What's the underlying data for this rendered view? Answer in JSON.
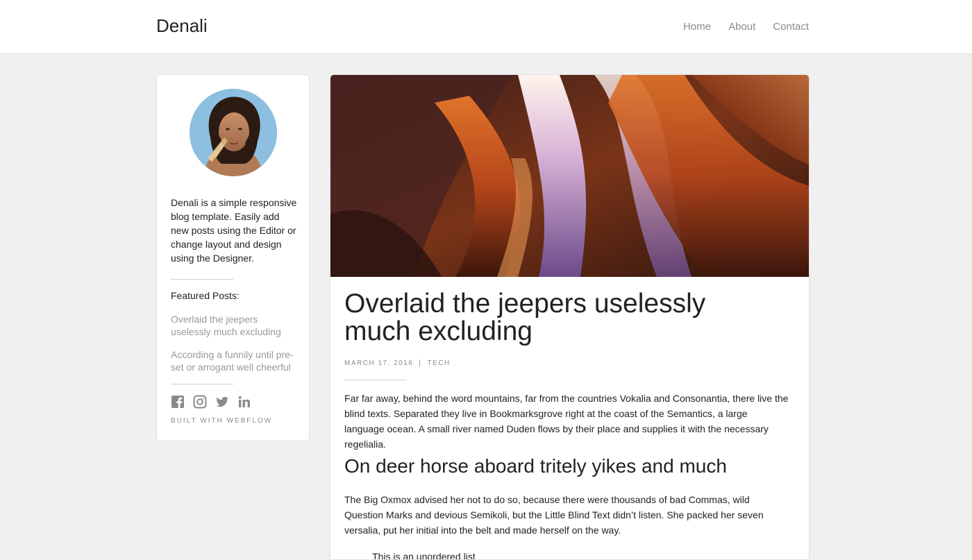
{
  "nav": {
    "brand": "Denali",
    "links": [
      "Home",
      "About",
      "Contact"
    ]
  },
  "sidebar": {
    "bio": "Denali is a simple responsive blog template. Easily add new posts using the Editor or change layout and design using the Designer.",
    "featured_title": "Featured Posts:",
    "featured": [
      "Overlaid the jeepers uselessly much excluding",
      "According a funnily until pre-set or arrogant well cheerful"
    ],
    "social_icons": [
      "facebook-icon",
      "instagram-icon",
      "twitter-icon",
      "linkedin-icon"
    ],
    "built_with": "BUILT WITH WEBFLOW"
  },
  "article": {
    "title": "Overlaid the jeepers uselessly much excluding",
    "date": "MARCH 17, 2016",
    "separator": "|",
    "category": "TECH",
    "intro": "Far far away, behind the word mountains, far from the countries Vokalia and Consonantia, there live the blind texts. Separated they live in Bookmarksgrove right at the coast of the Semantics, a large language ocean. A small river named Duden flows by their place and supplies it with the necessary regelialia.",
    "subheading": "On deer horse aboard tritely yikes and much",
    "paragraph2": "The Big Oxmox advised her not to do so, because there were thousands of bad Commas, wild Question Marks and devious Semikoli, but the Little Blind Text didn’t listen. She packed her seven versalia, put her initial into the belt and made herself on the way.",
    "list_item": "This is an unordered list"
  },
  "colors": {
    "page_bg": "#f0f0f0",
    "card_bg": "#ffffff",
    "muted_text": "#999999",
    "text": "#222222"
  }
}
